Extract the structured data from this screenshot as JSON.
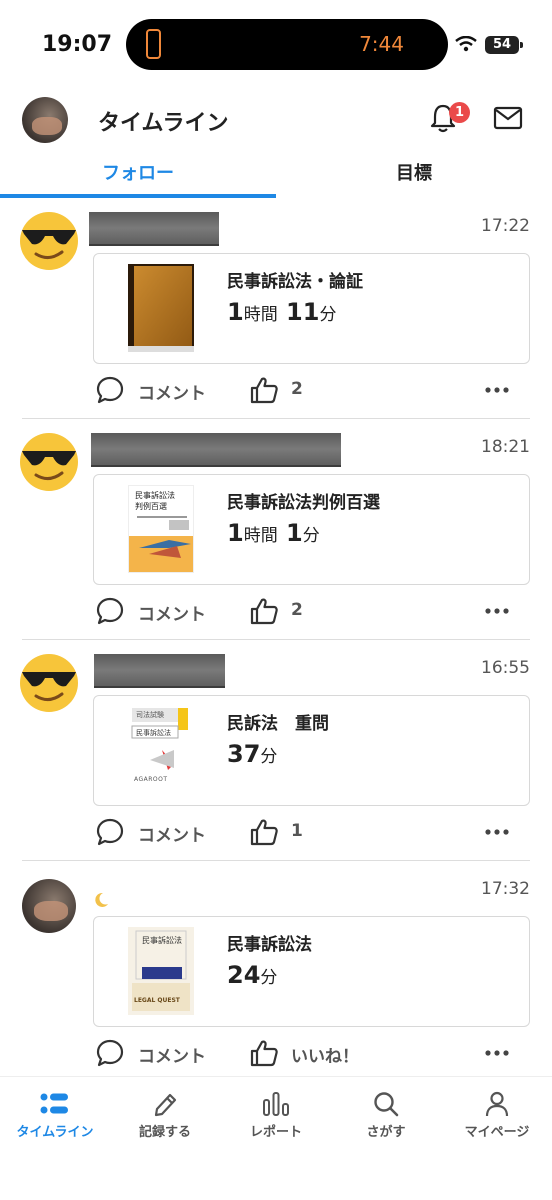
{
  "status_bar": {
    "time": "19:07",
    "island_time": "7:44",
    "battery": "54"
  },
  "header": {
    "title": "タイムライン",
    "notification_count": "1"
  },
  "tabs": [
    {
      "label": "フォロー",
      "active": true
    },
    {
      "label": "目標",
      "active": false
    }
  ],
  "posts": [
    {
      "time": "17:22",
      "book_title": "民事訴訟法・論証",
      "duration_parts": [
        "1",
        "時間",
        " 11",
        "分"
      ],
      "comment_label": "コメント",
      "like_label": "2"
    },
    {
      "time": "18:21",
      "book_title": "民事訴訟法判例百選",
      "duration_parts": [
        "1",
        "時間",
        " 1",
        "分"
      ],
      "comment_label": "コメント",
      "like_label": "2",
      "cover_text": [
        "民事訴訟法",
        "判例百選"
      ]
    },
    {
      "time": "16:55",
      "book_title": "民訴法　重問",
      "duration_parts": [
        "37",
        "分"
      ],
      "comment_label": "コメント",
      "like_label": "1",
      "cover_text": [
        "司法試験",
        "民事訴訟法",
        "AGAROOT"
      ]
    },
    {
      "time": "17:32",
      "book_title": "民事訴訟法",
      "duration_parts": [
        "24",
        "分"
      ],
      "comment_label": "コメント",
      "like_label": "いいね！",
      "cover_text": [
        "民事訴訟法",
        "LEGAL QUEST"
      ]
    }
  ],
  "bottom_nav": [
    {
      "label": "タイムライン",
      "icon": "timeline-icon",
      "active": true
    },
    {
      "label": "記録する",
      "icon": "pencil-icon",
      "active": false
    },
    {
      "label": "レポート",
      "icon": "bar-chart-icon",
      "active": false
    },
    {
      "label": "さがす",
      "icon": "search-icon",
      "active": false
    },
    {
      "label": "マイページ",
      "icon": "person-icon",
      "active": false
    }
  ],
  "colors": {
    "accent": "#1e88e5",
    "badge": "#ea4a4a",
    "island_text": "#f0883a"
  }
}
